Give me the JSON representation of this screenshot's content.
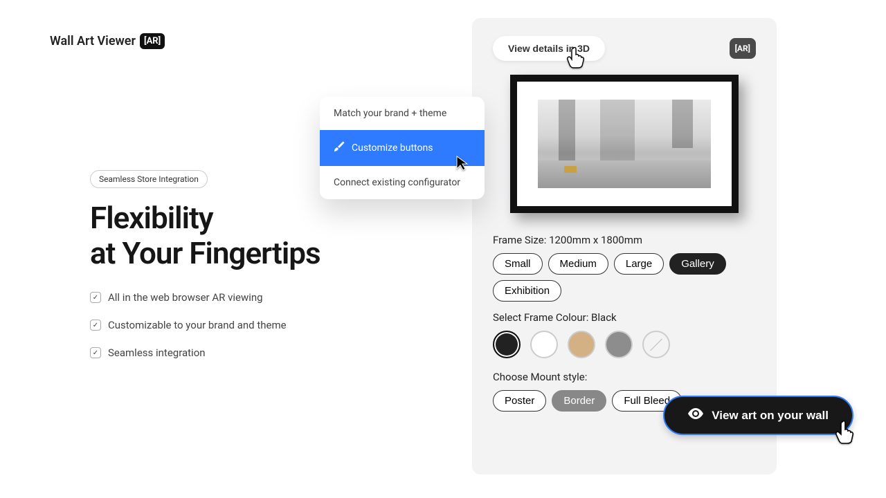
{
  "logo": {
    "text": "Wall Art Viewer",
    "badge": "[AR]"
  },
  "left": {
    "tag": "Seamless Store Integration",
    "hero_line1": "Flexibility",
    "hero_line2": "at Your Fingertips",
    "features": [
      "All in the web browser AR viewing",
      "Customizable to your brand and theme",
      "Seamless integration"
    ]
  },
  "dropdown": {
    "items": [
      {
        "label": "Match your brand + theme",
        "active": false
      },
      {
        "label": "Customize buttons",
        "active": true
      },
      {
        "label": "Connect existing configurator",
        "active": false
      }
    ]
  },
  "card": {
    "details_button": "View details in 3D",
    "ar_chip": "[AR]",
    "frame_size_label": "Frame Size: 1200mm x 1800mm",
    "sizes": [
      {
        "label": "Small",
        "active": false
      },
      {
        "label": "Medium",
        "active": false
      },
      {
        "label": "Large",
        "active": false
      },
      {
        "label": "Gallery",
        "active": true
      },
      {
        "label": "Exhibition",
        "active": false
      }
    ],
    "colour_label": "Select Frame Colour: Black",
    "swatches": [
      {
        "name": "black",
        "color": "#222222",
        "selected": true,
        "diag": false
      },
      {
        "name": "white",
        "color": "#ffffff",
        "selected": false,
        "diag": false
      },
      {
        "name": "oak",
        "color": "#d4b185",
        "selected": false,
        "diag": false
      },
      {
        "name": "grey",
        "color": "#8d8d8d",
        "selected": false,
        "diag": false
      },
      {
        "name": "none",
        "color": "#f3f3f3",
        "selected": false,
        "diag": true
      }
    ],
    "mount_label": "Choose Mount style:",
    "mounts": [
      {
        "label": "Poster",
        "state": "plain"
      },
      {
        "label": "Border",
        "state": "sel"
      },
      {
        "label": "Full Bleed",
        "state": "plain"
      }
    ]
  },
  "cta": {
    "label": "View art on your wall"
  }
}
